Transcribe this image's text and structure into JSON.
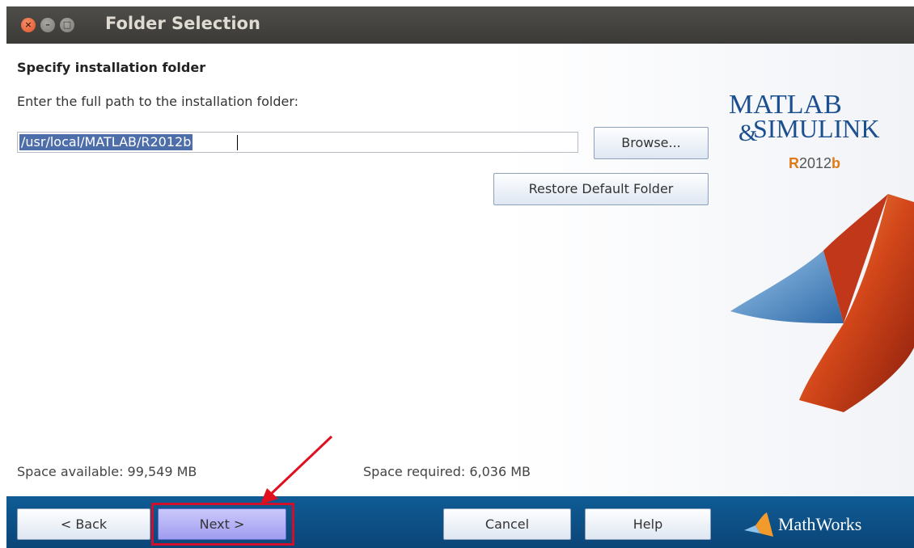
{
  "window": {
    "title": "Folder Selection",
    "close_glyph": "×",
    "min_glyph": "–",
    "max_glyph": "□"
  },
  "main": {
    "heading": "Specify installation folder",
    "instruction": "Enter the full path to the installation folder:",
    "path_value": "/usr/local/MATLAB/R2012b",
    "browse_label": "Browse...",
    "restore_label": "Restore Default Folder"
  },
  "logo": {
    "line1": "MATLAB",
    "line2": "SIMULINK",
    "amp": "&",
    "release_r": "R",
    "release_year": "2012",
    "release_b": "b"
  },
  "space": {
    "available": "Space available: 99,549 MB",
    "required": "Space required: 6,036 MB"
  },
  "footer": {
    "back_label": "< Back",
    "next_label": "Next >",
    "cancel_label": "Cancel",
    "help_label": "Help",
    "brand": "MathWorks"
  },
  "colors": {
    "titlebar": "#3c3b37",
    "footer": "#0b4f86",
    "selection": "#4d6ea8",
    "highlight": "#d0102a",
    "next_button": "#b4b1f7"
  },
  "icons": [
    "close-icon",
    "minimize-icon",
    "maximize-icon",
    "matlab-membrane-icon",
    "mathworks-logo-icon",
    "annotation-arrow-icon"
  ]
}
